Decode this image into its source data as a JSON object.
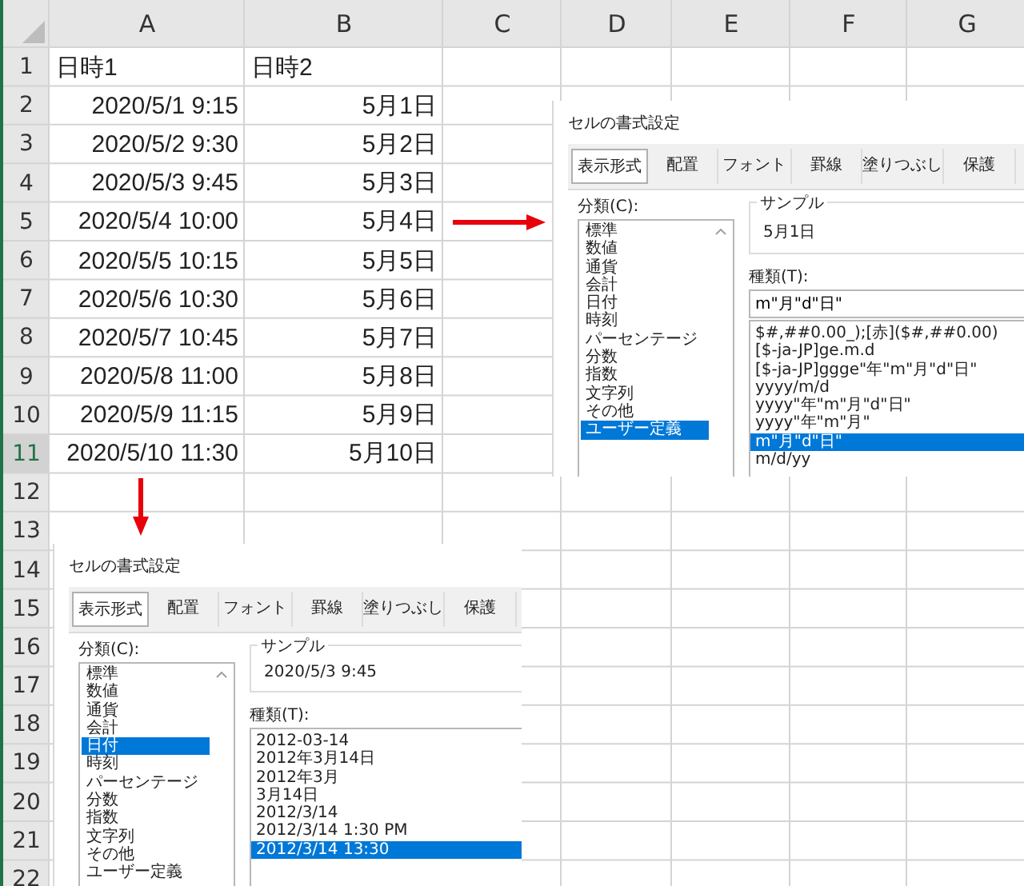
{
  "sheet": {
    "columns": [
      {
        "label": "A",
        "selected": false
      },
      {
        "label": "B",
        "selected": false
      },
      {
        "label": "C",
        "selected": false
      },
      {
        "label": "D",
        "selected": false
      },
      {
        "label": "E",
        "selected": false
      },
      {
        "label": "F",
        "selected": false
      },
      {
        "label": "G",
        "selected": false
      }
    ],
    "rows": [
      {
        "label": "1",
        "selected": false,
        "cells": [
          {
            "text": "日時1",
            "kind": "text"
          },
          {
            "text": "日時2",
            "kind": "text"
          }
        ]
      },
      {
        "label": "2",
        "selected": false,
        "cells": [
          {
            "text": "2020/5/1 9:15",
            "kind": "value"
          },
          {
            "text": "5月1日",
            "kind": "value"
          }
        ]
      },
      {
        "label": "3",
        "selected": false,
        "cells": [
          {
            "text": "2020/5/2 9:30",
            "kind": "value"
          },
          {
            "text": "5月2日",
            "kind": "value"
          }
        ]
      },
      {
        "label": "4",
        "selected": false,
        "cells": [
          {
            "text": "2020/5/3 9:45",
            "kind": "value"
          },
          {
            "text": "5月3日",
            "kind": "value"
          }
        ]
      },
      {
        "label": "5",
        "selected": false,
        "cells": [
          {
            "text": "2020/5/4 10:00",
            "kind": "value"
          },
          {
            "text": "5月4日",
            "kind": "value"
          }
        ]
      },
      {
        "label": "6",
        "selected": false,
        "cells": [
          {
            "text": "2020/5/5 10:15",
            "kind": "value"
          },
          {
            "text": "5月5日",
            "kind": "value"
          }
        ]
      },
      {
        "label": "7",
        "selected": false,
        "cells": [
          {
            "text": "2020/5/6 10:30",
            "kind": "value"
          },
          {
            "text": "5月6日",
            "kind": "value"
          }
        ]
      },
      {
        "label": "8",
        "selected": false,
        "cells": [
          {
            "text": "2020/5/7 10:45",
            "kind": "value"
          },
          {
            "text": "5月7日",
            "kind": "value"
          }
        ]
      },
      {
        "label": "9",
        "selected": false,
        "cells": [
          {
            "text": "2020/5/8 11:00",
            "kind": "value"
          },
          {
            "text": "5月8日",
            "kind": "value"
          }
        ]
      },
      {
        "label": "10",
        "selected": false,
        "cells": [
          {
            "text": "2020/5/9 11:15",
            "kind": "value"
          },
          {
            "text": "5月9日",
            "kind": "value"
          }
        ]
      },
      {
        "label": "11",
        "selected": true,
        "cells": [
          {
            "text": "2020/5/10 11:30",
            "kind": "value"
          },
          {
            "text": "5月10日",
            "kind": "value"
          }
        ]
      },
      {
        "label": "12",
        "selected": false,
        "cells": []
      },
      {
        "label": "13",
        "selected": false,
        "cells": []
      },
      {
        "label": "14",
        "selected": false,
        "cells": []
      },
      {
        "label": "15",
        "selected": false,
        "cells": []
      },
      {
        "label": "16",
        "selected": false,
        "cells": []
      },
      {
        "label": "17",
        "selected": false,
        "cells": []
      },
      {
        "label": "18",
        "selected": false,
        "cells": []
      },
      {
        "label": "19",
        "selected": false,
        "cells": []
      },
      {
        "label": "20",
        "selected": false,
        "cells": []
      },
      {
        "label": "21",
        "selected": false,
        "cells": []
      },
      {
        "label": "22",
        "selected": false,
        "cells": []
      }
    ]
  },
  "dialogs": [
    {
      "title": "セルの書式設定",
      "tabs": [
        {
          "label": "表示形式",
          "selected": true
        },
        {
          "label": "配置",
          "selected": false
        },
        {
          "label": "フォント",
          "selected": false
        },
        {
          "label": "罫線",
          "selected": false
        },
        {
          "label": "塗りつぶし",
          "selected": false
        },
        {
          "label": "保護",
          "selected": false
        }
      ],
      "category_label": "分類(C):",
      "categories": [
        {
          "label": "標準",
          "selected": false
        },
        {
          "label": "数値",
          "selected": false
        },
        {
          "label": "通貨",
          "selected": false
        },
        {
          "label": "会計",
          "selected": false
        },
        {
          "label": "日付",
          "selected": false
        },
        {
          "label": "時刻",
          "selected": false
        },
        {
          "label": "パーセンテージ",
          "selected": false
        },
        {
          "label": "分数",
          "selected": false
        },
        {
          "label": "指数",
          "selected": false
        },
        {
          "label": "文字列",
          "selected": false
        },
        {
          "label": "その他",
          "selected": false
        },
        {
          "label": "ユーザー定義",
          "selected": true
        }
      ],
      "sample_label": "サンプル",
      "sample": "5月1日",
      "type_label": "種類(T):",
      "type_value": "m\"月\"d\"日\"",
      "types": [
        {
          "label": "$#,##0.00_);[赤]($#,##0.00)",
          "selected": false
        },
        {
          "label": "[$-ja-JP]ge.m.d",
          "selected": false
        },
        {
          "label": "[$-ja-JP]ggge\"年\"m\"月\"d\"日\"",
          "selected": false
        },
        {
          "label": "yyyy/m/d",
          "selected": false
        },
        {
          "label": "yyyy\"年\"m\"月\"d\"日\"",
          "selected": false
        },
        {
          "label": "yyyy\"年\"m\"月\"",
          "selected": false
        },
        {
          "label": "m\"月\"d\"日\"",
          "selected": true
        },
        {
          "label": "m/d/yy",
          "selected": false
        }
      ]
    },
    {
      "title": "セルの書式設定",
      "tabs": [
        {
          "label": "表示形式",
          "selected": true
        },
        {
          "label": "配置",
          "selected": false
        },
        {
          "label": "フォント",
          "selected": false
        },
        {
          "label": "罫線",
          "selected": false
        },
        {
          "label": "塗りつぶし",
          "selected": false
        },
        {
          "label": "保護",
          "selected": false
        }
      ],
      "category_label": "分類(C):",
      "categories": [
        {
          "label": "標準",
          "selected": false
        },
        {
          "label": "数値",
          "selected": false
        },
        {
          "label": "通貨",
          "selected": false
        },
        {
          "label": "会計",
          "selected": false
        },
        {
          "label": "日付",
          "selected": true
        },
        {
          "label": "時刻",
          "selected": false
        },
        {
          "label": "パーセンテージ",
          "selected": false
        },
        {
          "label": "分数",
          "selected": false
        },
        {
          "label": "指数",
          "selected": false
        },
        {
          "label": "文字列",
          "selected": false
        },
        {
          "label": "その他",
          "selected": false
        },
        {
          "label": "ユーザー定義",
          "selected": false
        }
      ],
      "sample_label": "サンプル",
      "sample": "2020/5/3 9:45",
      "type_label": "種類(T):",
      "types": [
        {
          "label": "2012-03-14",
          "selected": false
        },
        {
          "label": "2012年3月14日",
          "selected": false
        },
        {
          "label": "2012年3月",
          "selected": false
        },
        {
          "label": "3月14日",
          "selected": false
        },
        {
          "label": "2012/3/14",
          "selected": false
        },
        {
          "label": "2012/3/14 1:30 PM",
          "selected": false
        },
        {
          "label": "2012/3/14 13:30",
          "selected": true
        }
      ]
    }
  ]
}
